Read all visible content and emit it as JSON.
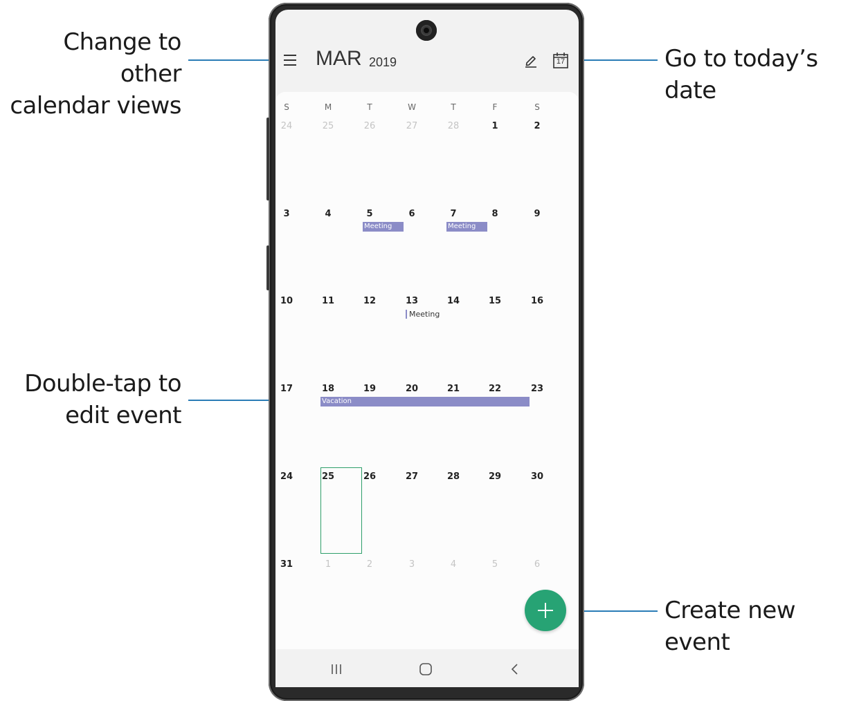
{
  "callouts": {
    "views": [
      "Change to other",
      "calendar views"
    ],
    "today": "Go to today’s date",
    "edit": [
      "Double-tap to",
      "edit event"
    ],
    "create": "Create new event"
  },
  "header": {
    "month": "MAR",
    "year": "2019",
    "today_icon_day": "17"
  },
  "calendar": {
    "weekdays": [
      "S",
      "M",
      "T",
      "W",
      "T",
      "F",
      "S"
    ],
    "weeks": [
      [
        "24",
        "25",
        "26",
        "27",
        "28",
        "1",
        "2"
      ],
      [
        "3",
        "4",
        "5",
        "6",
        "7",
        "8",
        "9"
      ],
      [
        "10",
        "11",
        "12",
        "13",
        "14",
        "15",
        "16"
      ],
      [
        "17",
        "18",
        "19",
        "20",
        "21",
        "22",
        "23"
      ],
      [
        "24",
        "25",
        "26",
        "27",
        "28",
        "29",
        "30"
      ],
      [
        "31",
        "1",
        "2",
        "3",
        "4",
        "5",
        "6"
      ]
    ],
    "events": {
      "meeting_5": "Meeting",
      "meeting_7": "Meeting",
      "meeting_13": "Meeting",
      "vacation": "Vacation"
    },
    "selected_day": "25"
  },
  "colors": {
    "accent": "#27a374",
    "event": "#8b8cc7",
    "callout_line": "#2a7cb6"
  },
  "icons": [
    "menu-icon",
    "edit-pen-icon",
    "today-calendar-icon",
    "plus-icon",
    "recent-apps-icon",
    "home-icon",
    "back-icon"
  ]
}
